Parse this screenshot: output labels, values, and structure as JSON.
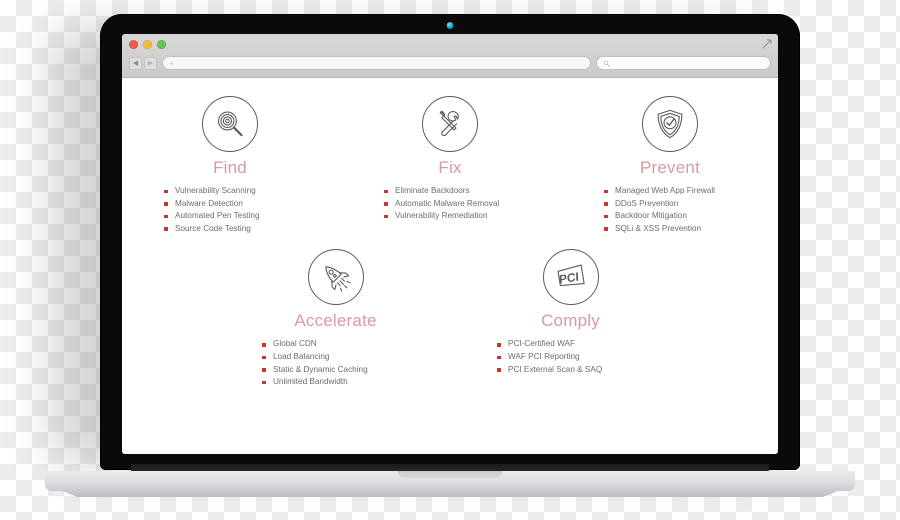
{
  "browser": {
    "traffic_lights": [
      "close",
      "minimize",
      "maximize"
    ],
    "back_glyph": "◀",
    "forward_glyph": "▶",
    "url_value": "",
    "url_placeholder": "+",
    "search_value": "",
    "search_placeholder": "",
    "resize_glyph": "↗"
  },
  "page": {
    "rows": [
      {
        "cards": [
          {
            "icon": "magnifier-target-icon",
            "title": "Find",
            "items": [
              "Vulnerability Scanning",
              "Malware Detection",
              "Automated Pen Testing",
              "Source Code Testing"
            ]
          },
          {
            "icon": "wrench-screwdriver-icon",
            "title": "Fix",
            "items": [
              "Eliminate Backdoors",
              "Automatic Malware Removal",
              "Vulnerability Remediation"
            ]
          },
          {
            "icon": "shield-check-icon",
            "title": "Prevent",
            "items": [
              "Managed Web App Firewall",
              "DDoS Prevention",
              "Backdoor Mitigation",
              "SQLi & XSS Prevention"
            ]
          }
        ]
      },
      {
        "cards": [
          {
            "icon": "rocket-icon",
            "title": "Accelerate",
            "items": [
              "Global CDN",
              "Load Balancing",
              "Static & Dynamic Caching",
              "Unlimited Bandwidth"
            ]
          },
          {
            "icon": "pci-card-icon",
            "title": "Comply",
            "items": [
              "PCI-Certified WAF",
              "WAF PCI Reporting",
              "PCI External Scan & SAQ"
            ]
          }
        ]
      }
    ]
  },
  "colors": {
    "heading": "#d99aa2",
    "bullet": "#c0392b",
    "body_text": "#6d6d6d",
    "icon_stroke": "#5b5b5b",
    "webcam": "#2aa9ce"
  }
}
